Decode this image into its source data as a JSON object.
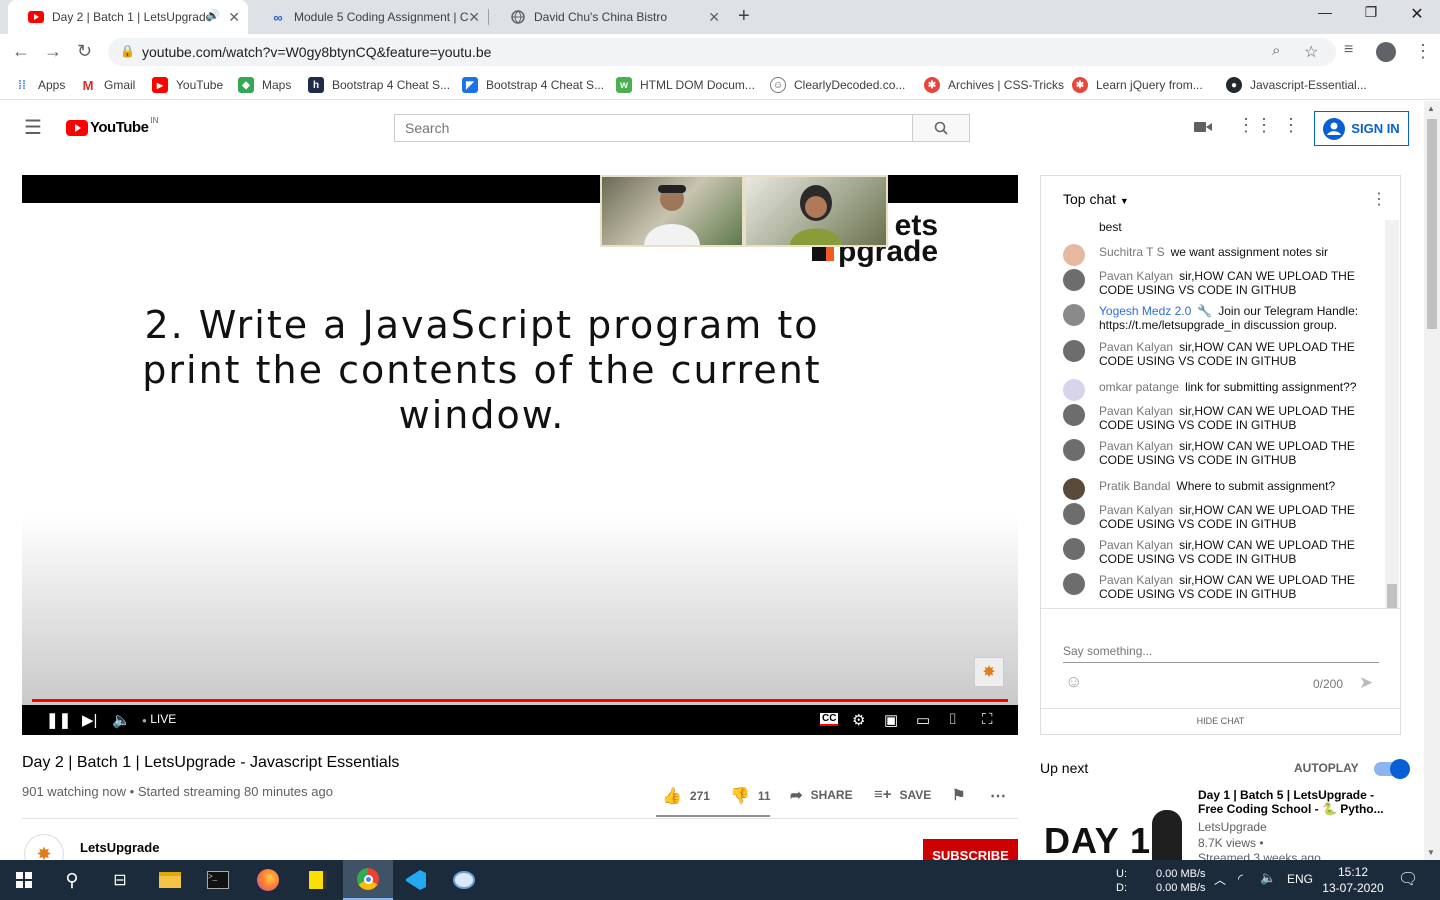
{
  "browser": {
    "tabs": [
      {
        "title": "Day 2 | Batch 1 | LetsUpgrade",
        "active": true
      },
      {
        "title": "Module 5 Coding Assignment | C",
        "active": false
      },
      {
        "title": "David Chu's China Bistro",
        "active": false
      }
    ],
    "url": "youtube.com/watch?v=W0gy8btynCQ&feature=youtu.be",
    "bookmarks": [
      "Apps",
      "Gmail",
      "YouTube",
      "Maps",
      "Bootstrap 4 Cheat S...",
      "Bootstrap 4 Cheat S...",
      "HTML DOM Docum...",
      "ClearlyDecoded.co...",
      "Archives | CSS-Tricks",
      "Learn jQuery from...",
      "Javascript-Essential..."
    ]
  },
  "masthead": {
    "logo_text": "YouTube",
    "region": "IN",
    "search_placeholder": "Search",
    "signin_label": "SIGN IN"
  },
  "player": {
    "slide_line1": "2. Write a JavaScript program to",
    "slide_line2": "print the contents of the current",
    "slide_line3": "window.",
    "logo_line1": "ets",
    "logo_line2": "pgrade",
    "live_label": "LIVE",
    "progress": 1.0
  },
  "video": {
    "title": "Day 2 | Batch 1 | LetsUpgrade - Javascript Essentials",
    "meta": "901 watching now • Started streaming 80 minutes ago",
    "likes": "271",
    "dislikes": "11",
    "share_label": "SHARE",
    "save_label": "SAVE",
    "channel": "LetsUpgrade",
    "subscribe_label": "SUBSCRIBE"
  },
  "chat": {
    "header": "Top chat",
    "messages": [
      {
        "author": "",
        "text": "best",
        "owner": false
      },
      {
        "author": "Suchitra T S",
        "text": "we want assignment notes sir",
        "owner": false
      },
      {
        "author": "Pavan Kalyan",
        "text": "sir,HOW CAN WE UPLOAD THE CODE USING VS CODE IN GITHUB",
        "owner": false
      },
      {
        "author": "Yogesh Medz 2.0",
        "text": "Join our Telegram Handle: https://t.me/letsupgrade_in discussion group.",
        "owner": true
      },
      {
        "author": "Pavan Kalyan",
        "text": "sir,HOW CAN WE UPLOAD THE CODE USING VS CODE IN GITHUB",
        "owner": false
      },
      {
        "author": "omkar patange",
        "text": "link for submitting assignment??",
        "owner": false
      },
      {
        "author": "Pavan Kalyan",
        "text": "sir,HOW CAN WE UPLOAD THE CODE USING VS CODE IN GITHUB",
        "owner": false
      },
      {
        "author": "Pavan Kalyan",
        "text": "sir,HOW CAN WE UPLOAD THE CODE USING VS CODE IN GITHUB",
        "owner": false
      },
      {
        "author": "Pratik Bandal",
        "text": "Where to submit assignment?",
        "owner": false
      },
      {
        "author": "Pavan Kalyan",
        "text": "sir,HOW CAN WE UPLOAD THE CODE USING VS CODE IN GITHUB",
        "owner": false
      },
      {
        "author": "Pavan Kalyan",
        "text": "sir,HOW CAN WE UPLOAD THE CODE USING VS CODE IN GITHUB",
        "owner": false
      },
      {
        "author": "Pavan Kalyan",
        "text": "sir,HOW CAN WE UPLOAD THE CODE USING VS CODE IN GITHUB",
        "owner": false
      }
    ],
    "input_placeholder": "Say something...",
    "char_count": "0/200",
    "hide_label": "HIDE CHAT"
  },
  "upnext": {
    "heading": "Up next",
    "autoplay_label": "AUTOPLAY",
    "thumb_label": "DAY 1",
    "item_title": "Day 1 | Batch 5 | LetsUpgrade - Free Coding School - 🐍 Pytho...",
    "item_channel": "LetsUpgrade",
    "item_views": "8.7K views •",
    "item_age": "Streamed 3 weeks ago"
  },
  "taskbar": {
    "net_up_label": "U:",
    "net_down_label": "D:",
    "net_up": "0.00 MB/s",
    "net_down": "0.00 MB/s",
    "lang": "ENG",
    "time": "15:12",
    "date": "13-07-2020"
  },
  "colors": {
    "accent": "#065fd4",
    "youtube_red": "#ff0000",
    "taskbar": "#1b2b3c"
  }
}
